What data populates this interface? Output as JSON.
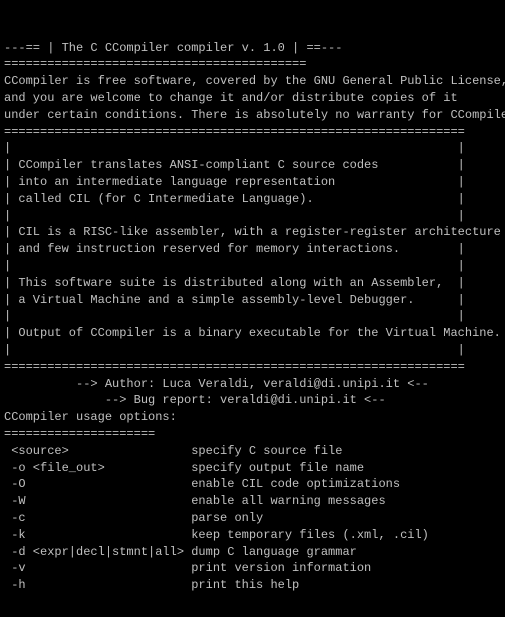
{
  "terminal": {
    "lines": [
      "---== | The C CCompiler compiler v. 1.0 | ==---",
      "==========================================",
      "CCompiler is free software, covered by the GNU General Public License,",
      "and you are welcome to change it and/or distribute copies of it",
      "under certain conditions. There is absolutely no warranty for CCompiler.",
      "",
      "================================================================",
      "|                                                              |",
      "| CCompiler translates ANSI-compliant C source codes           |",
      "| into an intermediate language representation                 |",
      "| called CIL (for C Intermediate Language).                    |",
      "|                                                              |",
      "| CIL is a RISC-like assembler, with a register-register architecture  |",
      "| and few instruction reserved for memory interactions.        |",
      "|                                                              |",
      "| This software suite is distributed along with an Assembler,  |",
      "| a Virtual Machine and a simple assembly-level Debugger.      |",
      "|                                                              |",
      "| Output of CCompiler is a binary executable for the Virtual Machine. |",
      "|                                                              |",
      "================================================================",
      "          --> Author: Luca Veraldi, veraldi@di.unipi.it <--",
      "              --> Bug report: veraldi@di.unipi.it <--",
      "",
      "CCompiler usage options:",
      "=====================",
      " <source>                 specify C source file",
      " -o <file_out>            specify output file name",
      " -O                       enable CIL code optimizations",
      " -W                       enable all warning messages",
      " -c                       parse only",
      " -k                       keep temporary files (.xml, .cil)",
      " -d <expr|decl|stmnt|all> dump C language grammar",
      " -v                       print version information",
      " -h                       print this help"
    ]
  }
}
